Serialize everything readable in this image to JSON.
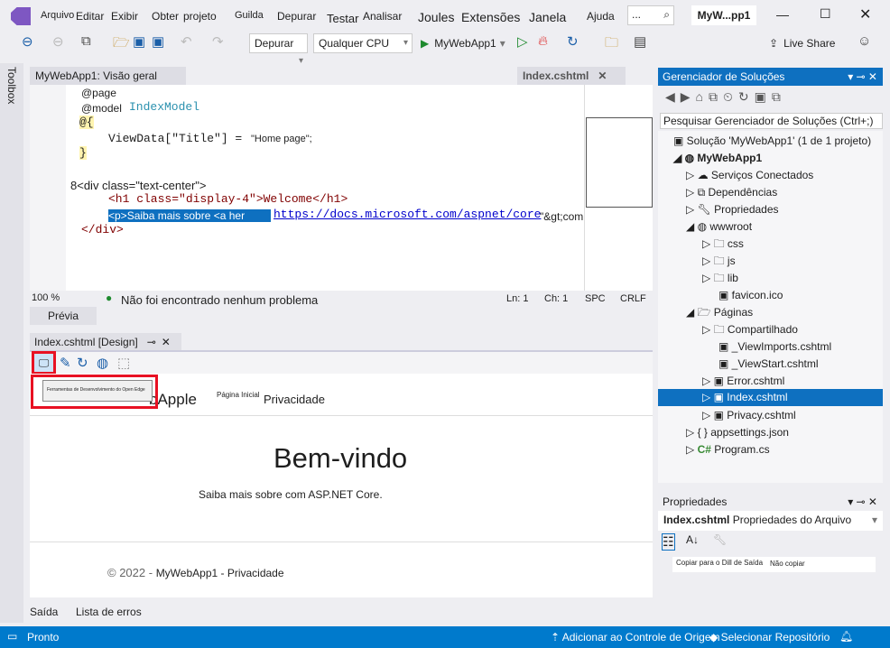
{
  "menu": [
    "Arquivo",
    "Editar",
    "Exibir",
    "Obter",
    "projeto",
    "Guilda",
    "Depurar",
    "Testar",
    "Analisar",
    "Joules",
    "Extensões",
    "Janela",
    "Ajuda"
  ],
  "search_placeholder": "...",
  "window_title": "MyW...pp1",
  "toolbar": {
    "config": "Depurar",
    "platform": "Qualquer CPU",
    "run_label": "MyWebApp1",
    "live_share": "Live Share"
  },
  "toolbox": "Toolbox",
  "editor": {
    "overview_tab": "MyWebApp1: Visão geral",
    "file_tab": "Index.cshtml",
    "lines": [
      "@page",
      "@model",
      "IndexModel",
      "@{",
      "ViewData[\"Title\"] = ",
      "\"Home page\";",
      "}",
      "8<div class=\"text-center\">",
      "<h1 class=\"display-4\">Welcome</h1>",
      "<p>Saiba mais sobre <a her",
      "https://docs.microsoft.com/aspnet/core",
      "\"&gt;compilação.",
      "</div>"
    ],
    "zoom": "100 %",
    "issues": "Não foi encontrado nenhum problema",
    "ln": "Ln: 1",
    "ch": "Ch: 1",
    "spc": "SPC",
    "crlf": "CRLF",
    "preview_tab": "Prévia"
  },
  "design": {
    "tab": "Index.cshtml [Design]",
    "tooltip": "Ferramentas de Desenvolvimento do Open Edge",
    "brand": "bApple",
    "nav_home": "Página Inicial",
    "nav_privacy": "Privacidade",
    "heading": "Bem-vindo",
    "lead": "Saiba mais sobre com ASP.NET Core.",
    "footer_copy": "© 2022 -",
    "footer_text": "MyWebApp1 - Privacidade"
  },
  "bottom_tabs": [
    "Saída",
    "Lista de erros"
  ],
  "solution": {
    "title": "Gerenciador de Soluções",
    "search": "Pesquisar Gerenciador de Soluções (Ctrl+;)",
    "items": [
      "Solução 'MyWebApp1' (1 de 1 projeto)",
      "MyWebApp1",
      "Serviços Conectados",
      "Dependências",
      "Propriedades",
      "wwwroot",
      "css",
      "js",
      "lib",
      "favicon.ico",
      "Páginas",
      "Compartilhado",
      "_ViewImports.cshtml",
      "_ViewStart.cshtml",
      "Error.cshtml",
      "Index.cshtml",
      "Privacy.cshtml",
      "appsettings.json",
      "Program.cs"
    ]
  },
  "properties": {
    "title": "Propriedades",
    "file": "Index.cshtml",
    "kind": "Propriedades do Arquivo",
    "prop_name": "Copiar para o Dill de Saída",
    "prop_value": "Não copiar"
  },
  "status": {
    "ready": "Pronto",
    "source_control": "Adicionar ao Controle de Origem",
    "repo": "Selecionar Repositório"
  }
}
